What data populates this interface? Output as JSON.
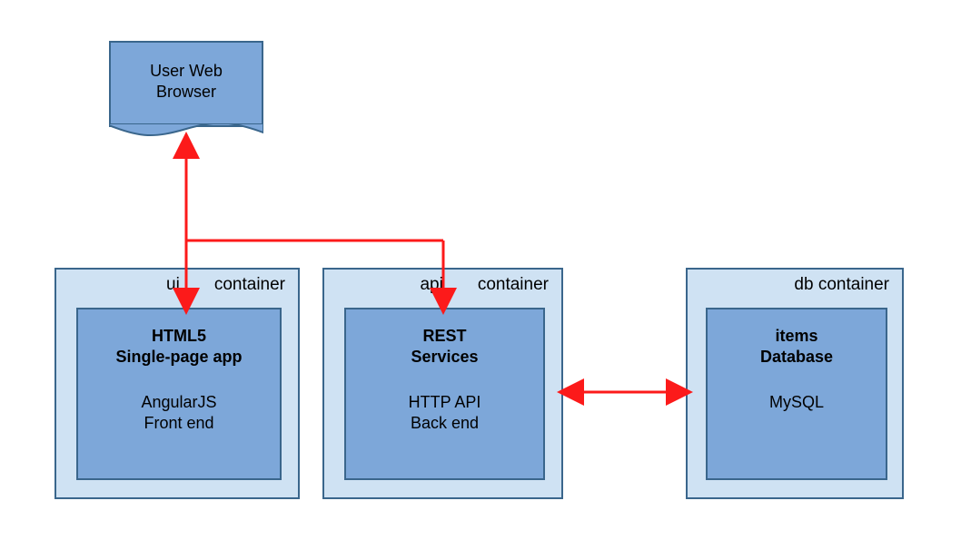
{
  "browser": {
    "label_line1": "User Web",
    "label_line2": "Browser"
  },
  "containers": {
    "ui": {
      "label": "ui  container",
      "title_line1": "HTML5",
      "title_line2": "Single-page app",
      "sub_line1": "AngularJS",
      "sub_line2": "Front end"
    },
    "api": {
      "label": "api  container",
      "title_line1": "REST",
      "title_line2": "Services",
      "sub_line1": "HTTP API",
      "sub_line2": "Back end"
    },
    "db": {
      "label": "db container",
      "title_line1": "items",
      "title_line2": "Database",
      "sub_line1": "MySQL",
      "sub_line2": ""
    }
  },
  "colors": {
    "arrow": "#fc1a1a",
    "box_fill": "#7da7d9",
    "outer_fill": "#cfe2f3",
    "border": "#3a668c"
  }
}
